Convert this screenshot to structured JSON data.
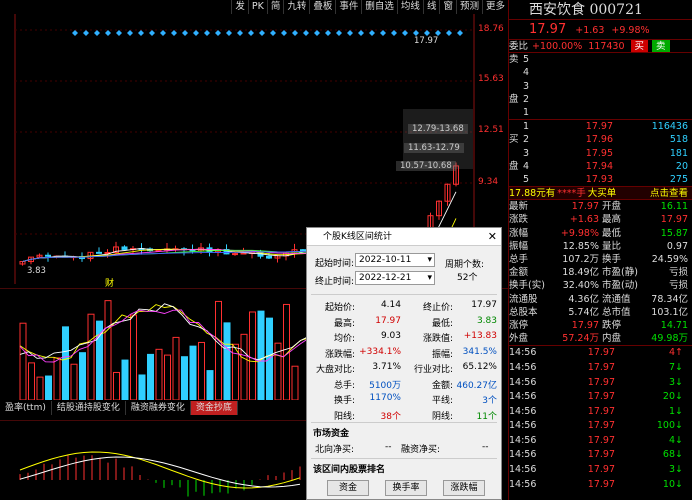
{
  "toolbar": [
    "发",
    "PK",
    "简",
    "九转",
    "叠板",
    "事件",
    "删自选",
    "均线",
    "线",
    "窗",
    "预测",
    "更多"
  ],
  "price_ticks": [
    "18.76",
    "15.63",
    "12.51",
    "9.34"
  ],
  "chart_labels": {
    "high": "17.97",
    "low": "3.83",
    "cost1": "12.79-13.68",
    "cost2": "11.63-12.79",
    "cost3": "10.57-10.68",
    "marker": "财"
  },
  "tabs": [
    "盈率(ttm)",
    "结股通持股变化",
    "融资融券变化",
    "资金抄底"
  ],
  "active_tab": 3,
  "stock": {
    "name": "西安饮食",
    "code": "000721",
    "price": "17.97",
    "change": "+1.63",
    "pct": "+9.98%",
    "weibi": "委比",
    "weibi_val": "+100.00%",
    "weicha": "117430",
    "buy_btn": "买",
    "sell_btn": "卖"
  },
  "sell_levels": [
    {
      "label": "卖",
      "n": "5"
    },
    {
      "label": "",
      "n": "4"
    },
    {
      "label": "",
      "n": "3"
    },
    {
      "label": "盘",
      "n": "2"
    },
    {
      "label": "",
      "n": "1"
    }
  ],
  "buy_levels": [
    {
      "label": "",
      "n": "1",
      "price": "17.97",
      "vol": "116436"
    },
    {
      "label": "买",
      "n": "2",
      "price": "17.96",
      "vol": "518"
    },
    {
      "label": "",
      "n": "3",
      "price": "17.95",
      "vol": "181"
    },
    {
      "label": "盘",
      "n": "4",
      "price": "17.94",
      "vol": "20"
    },
    {
      "label": "",
      "n": "5",
      "price": "17.93",
      "vol": "275"
    }
  ],
  "promo": {
    "left": "17.88元有",
    "mid": "****手",
    "mid2": "大买单",
    "right": "点击查看"
  },
  "quotes": [
    {
      "k1": "最新",
      "v1": "17.97",
      "c1": "red",
      "k2": "开盘",
      "v2": "16.11",
      "c2": "grn"
    },
    {
      "k1": "涨跌",
      "v1": "+1.63",
      "c1": "red",
      "k2": "最高",
      "v2": "17.97",
      "c2": "red"
    },
    {
      "k1": "涨幅",
      "v1": "+9.98%",
      "c1": "red",
      "k2": "最低",
      "v2": "15.87",
      "c2": "grn"
    },
    {
      "k1": "振幅",
      "v1": "12.85%",
      "c1": "wht",
      "k2": "量比",
      "v2": "0.97",
      "c2": "wht"
    },
    {
      "k1": "总手",
      "v1": "107.2万",
      "c1": "wht",
      "k2": "换手",
      "v2": "24.59%",
      "c2": "wht"
    },
    {
      "k1": "金额",
      "v1": "18.49亿",
      "c1": "wht",
      "k2": "市盈(静)",
      "v2": "亏损",
      "c2": "wht"
    },
    {
      "k1": "换手(实)",
      "v1": "32.40%",
      "c1": "wht",
      "k2": "市盈(动)",
      "v2": "亏损",
      "c2": "wht"
    },
    {
      "k1": "流通股",
      "v1": "4.36亿",
      "c1": "wht",
      "k2": "流通值",
      "v2": "78.34亿",
      "c2": "wht"
    },
    {
      "k1": "总股本",
      "v1": "5.74亿",
      "c1": "wht",
      "k2": "总市值",
      "v2": "103.1亿",
      "c2": "wht"
    },
    {
      "k1": "涨停",
      "v1": "17.97",
      "c1": "red",
      "k2": "跌停",
      "v2": "14.71",
      "c2": "grn"
    },
    {
      "k1": "外盘",
      "v1": "57.24万",
      "c1": "red",
      "k2": "内盘",
      "v2": "49.98万",
      "c2": "grn"
    }
  ],
  "ticks": [
    {
      "t": "14:56",
      "p": "17.97",
      "v": "4",
      "d": "up"
    },
    {
      "t": "14:56",
      "p": "17.97",
      "v": "7",
      "d": "down"
    },
    {
      "t": "14:56",
      "p": "17.97",
      "v": "3",
      "d": "down"
    },
    {
      "t": "14:56",
      "p": "17.97",
      "v": "20",
      "d": "down"
    },
    {
      "t": "14:56",
      "p": "17.97",
      "v": "1",
      "d": "down"
    },
    {
      "t": "14:56",
      "p": "17.97",
      "v": "100",
      "d": "down"
    },
    {
      "t": "14:56",
      "p": "17.97",
      "v": "4",
      "d": "down"
    },
    {
      "t": "14:56",
      "p": "17.97",
      "v": "68",
      "d": "down"
    },
    {
      "t": "14:56",
      "p": "17.97",
      "v": "3",
      "d": "down"
    },
    {
      "t": "14:56",
      "p": "17.97",
      "v": "10",
      "d": "down"
    }
  ],
  "dialog": {
    "title": "个股K线区间统计",
    "start_label": "起始时间:",
    "start": "2022-10-11",
    "end_label": "终止时间:",
    "end": "2022-12-21",
    "period_label": "周期个数:",
    "period": "52个",
    "stats": [
      {
        "k1": "起始价:",
        "v1": "4.14",
        "c1": "k",
        "k2": "终止价:",
        "v2": "17.97",
        "c2": "k"
      },
      {
        "k1": "最高:",
        "v1": "17.97",
        "c1": "r",
        "k2": "最低:",
        "v2": "3.83",
        "c2": "g"
      },
      {
        "k1": "均价:",
        "v1": "9.03",
        "c1": "k",
        "k2": "涨跌值:",
        "v2": "+13.83",
        "c2": "r"
      },
      {
        "k1": "涨跌幅:",
        "v1": "+334.1%",
        "c1": "r",
        "k2": "振幅:",
        "v2": "341.5%",
        "c2": "b"
      },
      {
        "k1": "大盘对比:",
        "v1": "3.71%",
        "c1": "k",
        "k2": "行业对比:",
        "v2": "65.12%",
        "c2": "k"
      },
      {
        "k1": "总手:",
        "v1": "5100万",
        "c1": "b",
        "k2": "金额:",
        "v2": "460.27亿",
        "c2": "b"
      },
      {
        "k1": "换手:",
        "v1": "1170%",
        "c1": "b",
        "k2": "平线:",
        "v2": "3个",
        "c2": "b"
      },
      {
        "k1": "阳线:",
        "v1": "38个",
        "c1": "r",
        "k2": "阴线:",
        "v2": "11个",
        "c2": "g"
      }
    ],
    "market_title": "市场资金",
    "north_label": "北向净买:",
    "north_val": "--",
    "margin_label": "融资净买:",
    "margin_val": "--",
    "rank_title": "该区间内股票排名",
    "buttons": [
      "资金",
      "换手率",
      "涨跌幅"
    ]
  }
}
